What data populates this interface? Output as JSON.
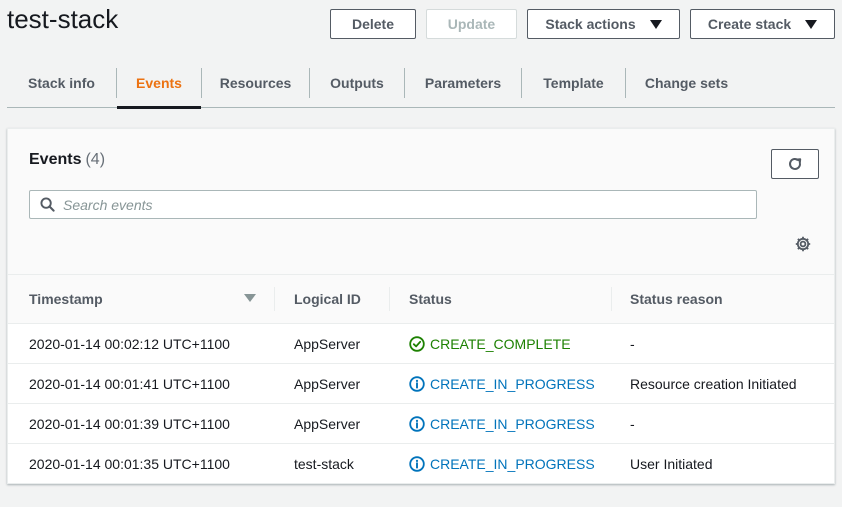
{
  "header": {
    "title": "test-stack",
    "buttons": {
      "delete": "Delete",
      "update": "Update",
      "stack_actions": "Stack actions",
      "create_stack": "Create stack"
    }
  },
  "tabs": [
    {
      "label": "Stack info",
      "active": false
    },
    {
      "label": "Events",
      "active": true
    },
    {
      "label": "Resources",
      "active": false
    },
    {
      "label": "Outputs",
      "active": false
    },
    {
      "label": "Parameters",
      "active": false
    },
    {
      "label": "Template",
      "active": false
    },
    {
      "label": "Change sets",
      "active": false
    }
  ],
  "events": {
    "title": "Events",
    "count": "(4)",
    "search_placeholder": "Search events",
    "columns": {
      "timestamp": "Timestamp",
      "logical_id": "Logical ID",
      "status": "Status",
      "status_reason": "Status reason"
    },
    "rows": [
      {
        "timestamp": "2020-01-14 00:02:12 UTC+1100",
        "logical_id": "AppServer",
        "status": "CREATE_COMPLETE",
        "status_kind": "success",
        "reason": "-"
      },
      {
        "timestamp": "2020-01-14 00:01:41 UTC+1100",
        "logical_id": "AppServer",
        "status": "CREATE_IN_PROGRESS",
        "status_kind": "info",
        "reason": "Resource creation Initiated"
      },
      {
        "timestamp": "2020-01-14 00:01:39 UTC+1100",
        "logical_id": "AppServer",
        "status": "CREATE_IN_PROGRESS",
        "status_kind": "info",
        "reason": "-"
      },
      {
        "timestamp": "2020-01-14 00:01:35 UTC+1100",
        "logical_id": "test-stack",
        "status": "CREATE_IN_PROGRESS",
        "status_kind": "info",
        "reason": "User Initiated"
      }
    ]
  },
  "colors": {
    "accent_active_tab": "#ec7211",
    "success": "#1d8102",
    "info": "#0073bb"
  },
  "icons": {
    "refresh": "refresh-icon",
    "search": "search-icon",
    "settings": "gear-icon",
    "success": "check-circle-icon",
    "info": "info-circle-icon"
  }
}
